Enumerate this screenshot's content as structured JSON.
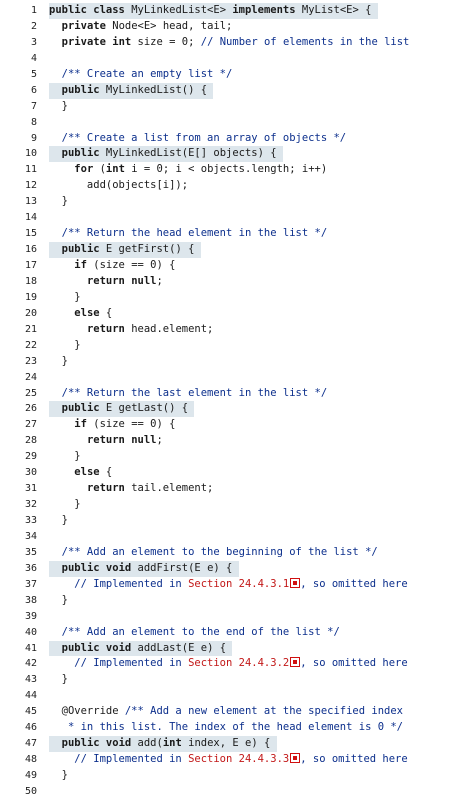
{
  "lines": [
    {
      "n": "1",
      "hl": true,
      "segs": [
        {
          "t": "public class MyLinkedList<E> implements MyList<E> {",
          "c": "n"
        }
      ]
    },
    {
      "n": "2",
      "segs": [
        {
          "t": "  private Node<E> head, tail;",
          "c": "n"
        }
      ]
    },
    {
      "n": "3",
      "segs": [
        {
          "t": "  private int size = 0; ",
          "c": "n"
        },
        {
          "t": "// Number of elements in the list",
          "c": "cm"
        }
      ]
    },
    {
      "n": "4",
      "segs": []
    },
    {
      "n": "5",
      "segs": [
        {
          "t": "  /** Create an empty list */",
          "c": "cm"
        }
      ]
    },
    {
      "n": "6",
      "hl": true,
      "segs": [
        {
          "t": "  public MyLinkedList() {",
          "c": "n"
        }
      ]
    },
    {
      "n": "7",
      "segs": [
        {
          "t": "  }",
          "c": "n"
        }
      ]
    },
    {
      "n": "8",
      "segs": []
    },
    {
      "n": "9",
      "segs": [
        {
          "t": "  /** Create a list from an array of objects */",
          "c": "cm"
        }
      ]
    },
    {
      "n": "10",
      "hl": true,
      "segs": [
        {
          "t": "  public MyLinkedList(E[] objects) {",
          "c": "n"
        }
      ]
    },
    {
      "n": "11",
      "segs": [
        {
          "t": "    for (int i = 0; i < objects.length; i++)",
          "c": "n"
        }
      ]
    },
    {
      "n": "12",
      "segs": [
        {
          "t": "      add(objects[i]);",
          "c": "n"
        }
      ]
    },
    {
      "n": "13",
      "segs": [
        {
          "t": "  }",
          "c": "n"
        }
      ]
    },
    {
      "n": "14",
      "segs": []
    },
    {
      "n": "15",
      "segs": [
        {
          "t": "  /** Return the head element in the list */",
          "c": "cm"
        }
      ]
    },
    {
      "n": "16",
      "hl": true,
      "segs": [
        {
          "t": "  public E getFirst() {",
          "c": "n"
        }
      ]
    },
    {
      "n": "17",
      "segs": [
        {
          "t": "    if (size == 0) {",
          "c": "n"
        }
      ]
    },
    {
      "n": "18",
      "segs": [
        {
          "t": "      return null;",
          "c": "n"
        }
      ]
    },
    {
      "n": "19",
      "segs": [
        {
          "t": "    }",
          "c": "n"
        }
      ]
    },
    {
      "n": "20",
      "segs": [
        {
          "t": "    else {",
          "c": "n"
        }
      ]
    },
    {
      "n": "21",
      "segs": [
        {
          "t": "      return head.element;",
          "c": "n"
        }
      ]
    },
    {
      "n": "22",
      "segs": [
        {
          "t": "    }",
          "c": "n"
        }
      ]
    },
    {
      "n": "23",
      "segs": [
        {
          "t": "  }",
          "c": "n"
        }
      ]
    },
    {
      "n": "24",
      "segs": []
    },
    {
      "n": "25",
      "segs": [
        {
          "t": "  /** Return the last element in the list */",
          "c": "cm"
        }
      ]
    },
    {
      "n": "26",
      "hl": true,
      "segs": [
        {
          "t": "  public E getLast() {",
          "c": "n"
        }
      ]
    },
    {
      "n": "27",
      "segs": [
        {
          "t": "    if (size == 0) {",
          "c": "n"
        }
      ]
    },
    {
      "n": "28",
      "segs": [
        {
          "t": "      return null;",
          "c": "n"
        }
      ]
    },
    {
      "n": "29",
      "segs": [
        {
          "t": "    }",
          "c": "n"
        }
      ]
    },
    {
      "n": "30",
      "segs": [
        {
          "t": "    else {",
          "c": "n"
        }
      ]
    },
    {
      "n": "31",
      "segs": [
        {
          "t": "      return tail.element;",
          "c": "n"
        }
      ]
    },
    {
      "n": "32",
      "segs": [
        {
          "t": "    }",
          "c": "n"
        }
      ]
    },
    {
      "n": "33",
      "segs": [
        {
          "t": "  }",
          "c": "n"
        }
      ]
    },
    {
      "n": "34",
      "segs": []
    },
    {
      "n": "35",
      "segs": [
        {
          "t": "  /** Add an element to the beginning of the list */",
          "c": "cm"
        }
      ]
    },
    {
      "n": "36",
      "hl": true,
      "segs": [
        {
          "t": "  public void addFirst(E e) {",
          "c": "n"
        }
      ]
    },
    {
      "n": "37",
      "segs": [
        {
          "t": "    // Implemented in ",
          "c": "cm"
        },
        {
          "t": "Section 24.4.3.1",
          "c": "sec"
        },
        {
          "t": "",
          "c": "ext"
        },
        {
          "t": ", so omitted here",
          "c": "cm"
        }
      ]
    },
    {
      "n": "38",
      "segs": [
        {
          "t": "  }",
          "c": "n"
        }
      ]
    },
    {
      "n": "39",
      "segs": []
    },
    {
      "n": "40",
      "segs": [
        {
          "t": "  /** Add an element to the end of the list */",
          "c": "cm"
        }
      ]
    },
    {
      "n": "41",
      "hl": true,
      "segs": [
        {
          "t": "  public void addLast(E e) {",
          "c": "n"
        }
      ]
    },
    {
      "n": "42",
      "segs": [
        {
          "t": "    // Implemented in ",
          "c": "cm"
        },
        {
          "t": "Section 24.4.3.2",
          "c": "sec"
        },
        {
          "t": "",
          "c": "ext"
        },
        {
          "t": ", so omitted here",
          "c": "cm"
        }
      ]
    },
    {
      "n": "43",
      "segs": [
        {
          "t": "  }",
          "c": "n"
        }
      ]
    },
    {
      "n": "44",
      "segs": []
    },
    {
      "n": "45",
      "segs": [
        {
          "t": "  @Override ",
          "c": "n"
        },
        {
          "t": "/** Add a new element at the specified index",
          "c": "cm"
        }
      ]
    },
    {
      "n": "46",
      "segs": [
        {
          "t": "   * in this list. The index of the head element is 0 */",
          "c": "cm"
        }
      ]
    },
    {
      "n": "47",
      "hl": true,
      "segs": [
        {
          "t": "  public void add(int index, E e) {",
          "c": "n"
        }
      ]
    },
    {
      "n": "48",
      "segs": [
        {
          "t": "    // Implemented in ",
          "c": "cm"
        },
        {
          "t": "Section 24.4.3.3",
          "c": "sec"
        },
        {
          "t": "",
          "c": "ext"
        },
        {
          "t": ", so omitted here",
          "c": "cm"
        }
      ]
    },
    {
      "n": "49",
      "segs": [
        {
          "t": "  }",
          "c": "n"
        }
      ]
    },
    {
      "n": "50",
      "segs": []
    }
  ],
  "icons": {
    "external": "external-link-icon"
  },
  "colors": {
    "comment": "#0c2f8c",
    "link": "#c21818",
    "highlight": "#dde6ec"
  }
}
